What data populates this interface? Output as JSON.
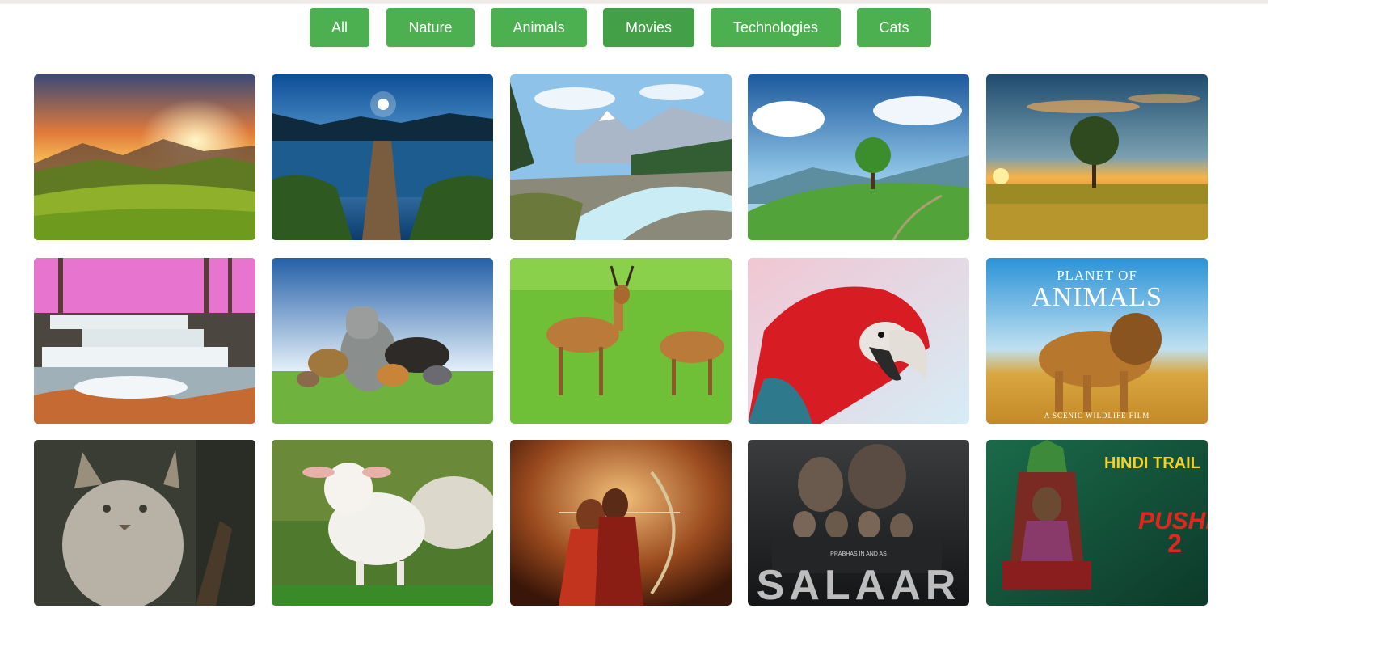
{
  "filters": {
    "buttons": [
      {
        "label": "All",
        "active": false
      },
      {
        "label": "Nature",
        "active": false
      },
      {
        "label": "Animals",
        "active": false
      },
      {
        "label": "Movies",
        "active": true
      },
      {
        "label": "Technologies",
        "active": false
      },
      {
        "label": "Cats",
        "active": false
      }
    ],
    "accent": "#4caf50",
    "accent_active": "#43a047"
  },
  "gallery": {
    "images": [
      {
        "category": "Nature",
        "subject": "mountain sunset meadow"
      },
      {
        "category": "Nature",
        "subject": "lake pier at night"
      },
      {
        "category": "Nature",
        "subject": "mountain river valley"
      },
      {
        "category": "Nature",
        "subject": "lone tree on green hill"
      },
      {
        "category": "Nature",
        "subject": "tree at sunset field"
      },
      {
        "category": "Nature",
        "subject": "waterfall pink forest"
      },
      {
        "category": "Animals",
        "subject": "group of wild animals"
      },
      {
        "category": "Animals",
        "subject": "antelopes on grass"
      },
      {
        "category": "Animals",
        "subject": "red macaw parrot"
      },
      {
        "category": "Animals",
        "subject": "lion poster",
        "title_line1": "PLANET OF",
        "title_line2": "ANIMALS",
        "caption": "A SCENIC WILDLIFE FILM"
      },
      {
        "category": "Cats",
        "subject": "lynx"
      },
      {
        "category": "Animals",
        "subject": "lamb"
      },
      {
        "category": "Movies",
        "subject": "archer couple poster"
      },
      {
        "category": "Movies",
        "subject": "Salaar poster",
        "title": "SALAAR",
        "credit": "PRABHAS IN AND AS"
      },
      {
        "category": "Movies",
        "subject": "Pushpa 2 poster",
        "banner": "HINDI TRAIL",
        "title": "PUSHPA",
        "number": "2"
      }
    ]
  }
}
